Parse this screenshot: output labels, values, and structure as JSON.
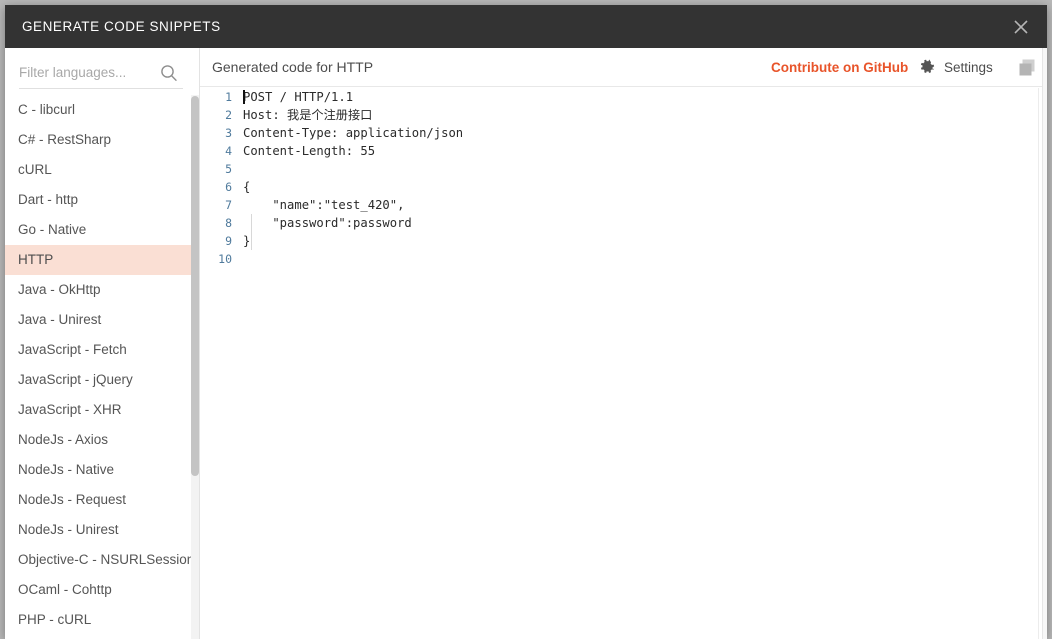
{
  "window": {
    "title": "GENERATE CODE SNIPPETS",
    "close_icon": "close-icon"
  },
  "sidebar": {
    "search": {
      "placeholder": "Filter languages...",
      "value": "",
      "icon": "search-icon"
    },
    "items": [
      {
        "label": "C - libcurl",
        "active": false
      },
      {
        "label": "C# - RestSharp",
        "active": false
      },
      {
        "label": "cURL",
        "active": false
      },
      {
        "label": "Dart - http",
        "active": false
      },
      {
        "label": "Go - Native",
        "active": false
      },
      {
        "label": "HTTP",
        "active": true
      },
      {
        "label": "Java - OkHttp",
        "active": false
      },
      {
        "label": "Java - Unirest",
        "active": false
      },
      {
        "label": "JavaScript - Fetch",
        "active": false
      },
      {
        "label": "JavaScript - jQuery",
        "active": false
      },
      {
        "label": "JavaScript - XHR",
        "active": false
      },
      {
        "label": "NodeJs - Axios",
        "active": false
      },
      {
        "label": "NodeJs - Native",
        "active": false
      },
      {
        "label": "NodeJs - Request",
        "active": false
      },
      {
        "label": "NodeJs - Unirest",
        "active": false
      },
      {
        "label": "Objective-C - NSURLSession",
        "active": false
      },
      {
        "label": "OCaml - Cohttp",
        "active": false
      },
      {
        "label": "PHP - cURL",
        "active": false
      }
    ]
  },
  "content": {
    "title": "Generated code for HTTP",
    "github_label": "Contribute on GitHub",
    "settings_label": "Settings",
    "gear_icon": "gear-icon",
    "copy_icon": "copy-icon"
  },
  "editor": {
    "line_numbers": [
      "1",
      "2",
      "3",
      "4",
      "5",
      "6",
      "7",
      "8",
      "9",
      "10"
    ],
    "lines": [
      "POST / HTTP/1.1",
      "Host: 我是个注册接口",
      "Content-Type: application/json",
      "Content-Length: 55",
      "",
      "{",
      "    \"name\":\"test_420\",",
      "    \"password\":password",
      "}",
      ""
    ]
  },
  "colors": {
    "titlebar_bg": "#333333",
    "accent_orange": "#e8542a",
    "active_item_bg": "#fadfd4",
    "line_number": "#4f7a9c",
    "code_text": "#2b2b2b"
  }
}
